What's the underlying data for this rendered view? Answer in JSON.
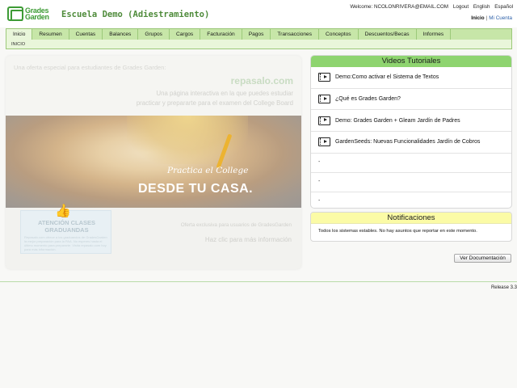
{
  "header": {
    "logo_line1": "Grades",
    "logo_line2": "Garden",
    "school_name": "Escuela Demo (Adiestramiento)",
    "welcome": "Welcome: NCOLONRIVERA@EMAIL.COM",
    "logout": "Logout",
    "english": "English",
    "espanol": "Español",
    "inicio_link": "Inicio",
    "separator": "|",
    "mi_cuenta": "Mi Cuenta"
  },
  "nav": {
    "items": [
      "Inicio",
      "Resumen",
      "Cuentas",
      "Balances",
      "Grupos",
      "Cargos",
      "Facturación",
      "Pagos",
      "Transacciones",
      "Conceptos",
      "Descuentos/Becas",
      "Informes"
    ],
    "breadcrumb": "INICIO"
  },
  "promo": {
    "lead": "Una oferta especial para estudiantes de Grades Garden:",
    "brand": "repasalo.com",
    "desc_line1": "Una página interactiva en la que puedes estudiar",
    "desc_line2": "practicar y prepararte para el examen del College Board",
    "photo_sub": "Practica el College",
    "photo_main": "DESDE TU CASA.",
    "att_title_line1": "ATENCIÓN CLASES",
    "att_title_line2": "GRADUANDAS",
    "att_text": "Repasalo.com ofrece a los graduandos de GradesGarden la mejor preparación para la PAA. No esperes hasta el último momento para prepararte. Visita repasalo.com hoy para más información.",
    "note": "Oferta exclusiva para usuarios de GradesGarden",
    "link": "Haz clic para más información"
  },
  "videos": {
    "title": "Videos Tutoriales",
    "items": [
      "Demo:Como activar el Sistema de Textos",
      "¿Qué es Grades Garden?",
      "Demo: Grades Garden + Gleam Jardín de Padres",
      "GardenSeeds: Nuevas Funcionalidades Jardín de Cobros"
    ],
    "empty_rows": [
      "-",
      "-",
      "-"
    ]
  },
  "notifications": {
    "title": "Notificaciones",
    "message": "Todos los sistemas estables. No hay asuntos que reportar en este momento."
  },
  "doc_button": "Ver Documentación",
  "release": "Release 3.3",
  "colors": {
    "brand_green": "#3d9b35",
    "nav_bg": "#c7e6a8",
    "videos_header": "#8ed46f",
    "notif_header": "#fbfba6"
  }
}
